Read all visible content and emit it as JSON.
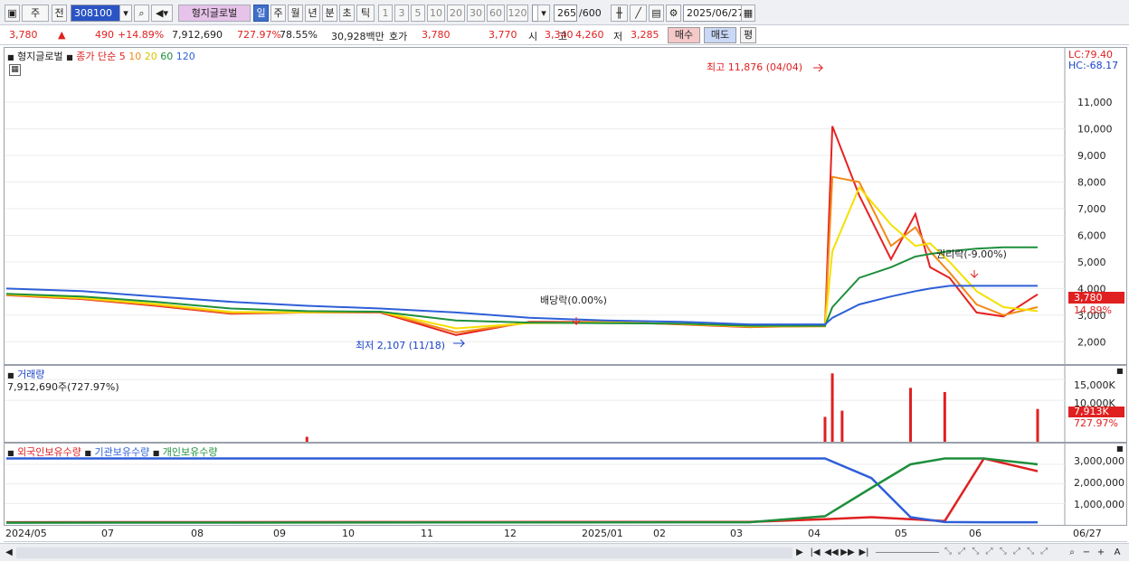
{
  "toolbar": {
    "market": "주",
    "prev": "전",
    "code": "308100",
    "stock_name": "형지글로벌",
    "periods": [
      "일",
      "주",
      "월",
      "년",
      "분",
      "초",
      "틱"
    ],
    "intervals": [
      "1",
      "3",
      "5",
      "10",
      "20",
      "30",
      "60",
      "120"
    ],
    "count": "265",
    "count_max": "/600",
    "date": "2025/06/27"
  },
  "quote": {
    "price": "3,780",
    "arrow": "▲",
    "change": "490",
    "change_pct": "+14.89%",
    "volume": "7,912,690",
    "volume_ratio": "727.97%",
    "turnover": "78.55%",
    "amount": "30,928백만",
    "bid_label": "호가",
    "ask": "3,780",
    "bid": "3,770",
    "open_label": "시",
    "open": "3,340",
    "high_label": "고",
    "high": "4,260",
    "low_label": "저",
    "low": "3,285",
    "buy": "매수",
    "sell": "매도",
    "avg": "평"
  },
  "price_panel": {
    "name": "형지글로벌",
    "ma_label": "종가 단순",
    "ma_periods": [
      "5",
      "10",
      "20",
      "60",
      "120"
    ],
    "ma_colors": [
      "#e52222",
      "#f28a1a",
      "#f5e000",
      "#1e8f3c",
      "#2e5fd8"
    ],
    "lc": "LC:79.40",
    "hc": "HC:-68.17",
    "y_ticks": [
      "11,000",
      "10,000",
      "9,000",
      "8,000",
      "7,000",
      "6,000",
      "5,000",
      "4,000",
      "3,000",
      "2,000"
    ],
    "annotations": {
      "high": "최고 11,876 (04/04)",
      "low": "최저 2,107 (11/18)",
      "dividend": "배당락(0.00%)",
      "rights": "권리락(-9.00%)"
    },
    "price_tag": "3,780",
    "pct_tag": "14.89%"
  },
  "volume_panel": {
    "name": "거래량",
    "value": "7,912,690주(727.97%)",
    "y_ticks": [
      "15,000K",
      "10,000K"
    ],
    "tag": "7,913K",
    "pct_tag": "727.97%"
  },
  "holdings_panel": {
    "legend": [
      "외국인보유수량",
      "기관보유수량",
      "개인보유수량"
    ],
    "legend_colors": [
      "#e02020",
      "#2e5fd8",
      "#1e8f3c"
    ],
    "y_ticks": [
      "3,000,000",
      "2,000,000",
      "1,000,000"
    ]
  },
  "x_axis": [
    "2024/05",
    "07",
    "08",
    "09",
    "10",
    "11",
    "12",
    "2025/01",
    "02",
    "03",
    "04",
    "05",
    "06"
  ],
  "x_end": "06/27",
  "chart_data": [
    {
      "type": "line",
      "title": "형지글로벌",
      "ylabel": "",
      "ylim": [
        1500,
        12500
      ],
      "x": [
        "2024/05",
        "2024/06",
        "2024/07",
        "2024/08",
        "2024/09",
        "2024/10",
        "2024/11",
        "2024/12",
        "2025/01",
        "2025/02",
        "2025/03",
        "2025/04/01",
        "2025/04/04",
        "2025/04/15",
        "2025/04/28",
        "2025/05/08",
        "2025/05/14",
        "2025/05/22",
        "2025/06/02",
        "2025/06/13",
        "2025/06/27"
      ],
      "series": [
        {
          "name": "5",
          "values": [
            3750,
            3600,
            3350,
            3050,
            3100,
            3100,
            2250,
            2750,
            2750,
            2650,
            2550,
            2600,
            10100,
            7500,
            5100,
            6800,
            4800,
            4400,
            3100,
            2950,
            3780
          ]
        },
        {
          "name": "10",
          "values": [
            3760,
            3620,
            3380,
            3080,
            3100,
            3120,
            2350,
            2720,
            2740,
            2660,
            2560,
            2580,
            8200,
            8000,
            5600,
            6300,
            5400,
            4600,
            3400,
            3000,
            3300
          ]
        },
        {
          "name": "20",
          "values": [
            3780,
            3650,
            3420,
            3120,
            3110,
            3130,
            2500,
            2700,
            2720,
            2670,
            2580,
            2600,
            5400,
            7800,
            6400,
            5600,
            5700,
            5000,
            3900,
            3300,
            3150
          ]
        },
        {
          "name": "60",
          "values": [
            3800,
            3700,
            3500,
            3250,
            3150,
            3130,
            2800,
            2720,
            2700,
            2680,
            2600,
            2600,
            3300,
            4400,
            4800,
            5200,
            5300,
            5400,
            5500,
            5550,
            5550
          ]
        },
        {
          "name": "120",
          "values": [
            4000,
            3900,
            3700,
            3500,
            3350,
            3250,
            3100,
            2900,
            2800,
            2750,
            2650,
            2650,
            2900,
            3400,
            3700,
            3900,
            4000,
            4100,
            4100,
            4100,
            4100
          ]
        }
      ]
    },
    {
      "type": "bar",
      "title": "거래량",
      "ylim": [
        0,
        17000
      ],
      "x": [
        "2024/09",
        "2025/04/01",
        "2025/04/04",
        "2025/04/08",
        "2025/05/06",
        "2025/05/20",
        "2025/06/27"
      ],
      "values": [
        1200,
        6000,
        16500,
        7500,
        13000,
        12000,
        7913
      ]
    },
    {
      "type": "line",
      "title": "",
      "ylim": [
        0,
        3600000
      ],
      "x": [
        "2024/05",
        "2025/03",
        "2025/04/01",
        "2025/04/20",
        "2025/05/06",
        "2025/05/20",
        "2025/06/05",
        "2025/06/27"
      ],
      "series": [
        {
          "name": "외국인보유수량",
          "values": [
            40000,
            60000,
            200000,
            300000,
            200000,
            100000,
            3300000,
            2650000
          ]
        },
        {
          "name": "기관보유수량",
          "values": [
            3300000,
            3300000,
            3300000,
            2300000,
            300000,
            50000,
            40000,
            40000
          ]
        },
        {
          "name": "개인보유수량",
          "values": [
            20000,
            40000,
            350000,
            1800000,
            3000000,
            3300000,
            3300000,
            3000000
          ]
        }
      ]
    }
  ],
  "scrollbar": {
    "left": "◀",
    "right": "▶",
    "buttons": [
      "|◀",
      "◀◀",
      "▶▶",
      "▶|"
    ],
    "tools": [
      "⌕",
      "−",
      "+",
      "A"
    ]
  }
}
